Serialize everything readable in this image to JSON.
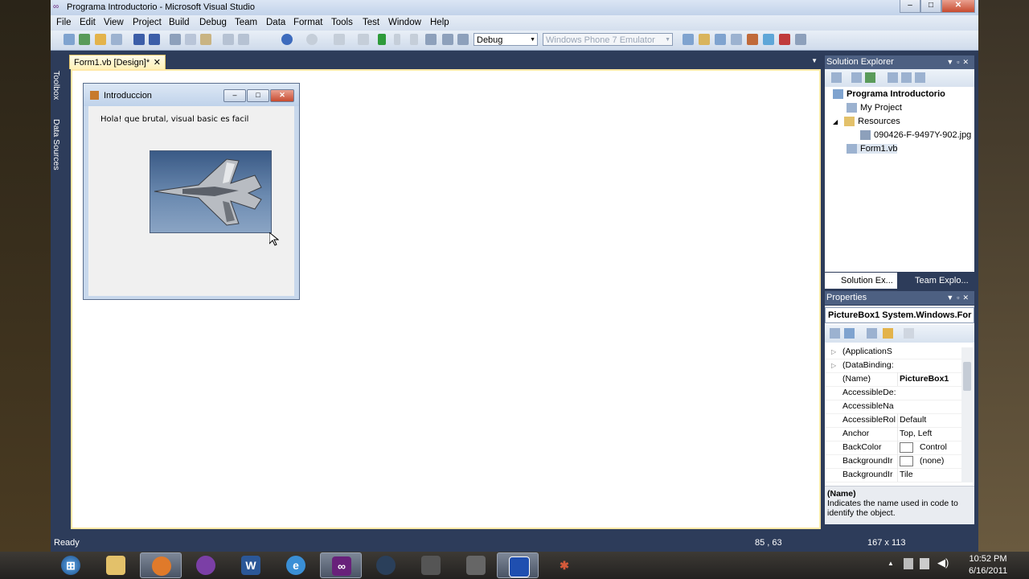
{
  "window": {
    "title": "Programa Introductorio - Microsoft Visual Studio"
  },
  "menu": [
    "File",
    "Edit",
    "View",
    "Project",
    "Build",
    "Debug",
    "Team",
    "Data",
    "Format",
    "Tools",
    "Test",
    "Window",
    "Help"
  ],
  "toolbar": {
    "config": "Debug",
    "target": "Windows Phone 7 Emulator"
  },
  "side_tabs": [
    "Toolbox",
    "Data Sources"
  ],
  "document_tab": "Form1.vb [Design]*",
  "form": {
    "title": "Introduccion",
    "label": "Hola! que brutal, visual basic es facil"
  },
  "solution_explorer": {
    "title": "Solution Explorer",
    "items": {
      "project": "Programa Introductorio",
      "my_project": "My Project",
      "resources": "Resources",
      "image": "090426-F-9497Y-902.jpg",
      "form": "Form1.vb"
    },
    "tabs": [
      "Solution Ex...",
      "Team Explo..."
    ]
  },
  "properties": {
    "title": "Properties",
    "selector": "PictureBox1  System.Windows.For",
    "rows": [
      {
        "name": "(ApplicationS",
        "value": ""
      },
      {
        "name": "(DataBinding:",
        "value": ""
      },
      {
        "name": "(Name)",
        "value": "PictureBox1"
      },
      {
        "name": "AccessibleDe:",
        "value": ""
      },
      {
        "name": "AccessibleNa",
        "value": ""
      },
      {
        "name": "AccessibleRol",
        "value": "Default"
      },
      {
        "name": "Anchor",
        "value": "Top, Left"
      },
      {
        "name": "BackColor",
        "value": "Control"
      },
      {
        "name": "BackgroundIr",
        "value": "(none)"
      },
      {
        "name": "BackgroundIr",
        "value": "Tile"
      }
    ],
    "desc_title": "(Name)",
    "desc_text": "Indicates the name used in code to identify the object."
  },
  "status": {
    "ready": "Ready",
    "position": "85 , 63",
    "size": "167 x 113"
  },
  "taskbar": {
    "time": "10:52 PM",
    "date": "6/16/2011"
  },
  "colors": {
    "accent": "#2d3c5a",
    "designer_border": "#ffe8a6"
  }
}
